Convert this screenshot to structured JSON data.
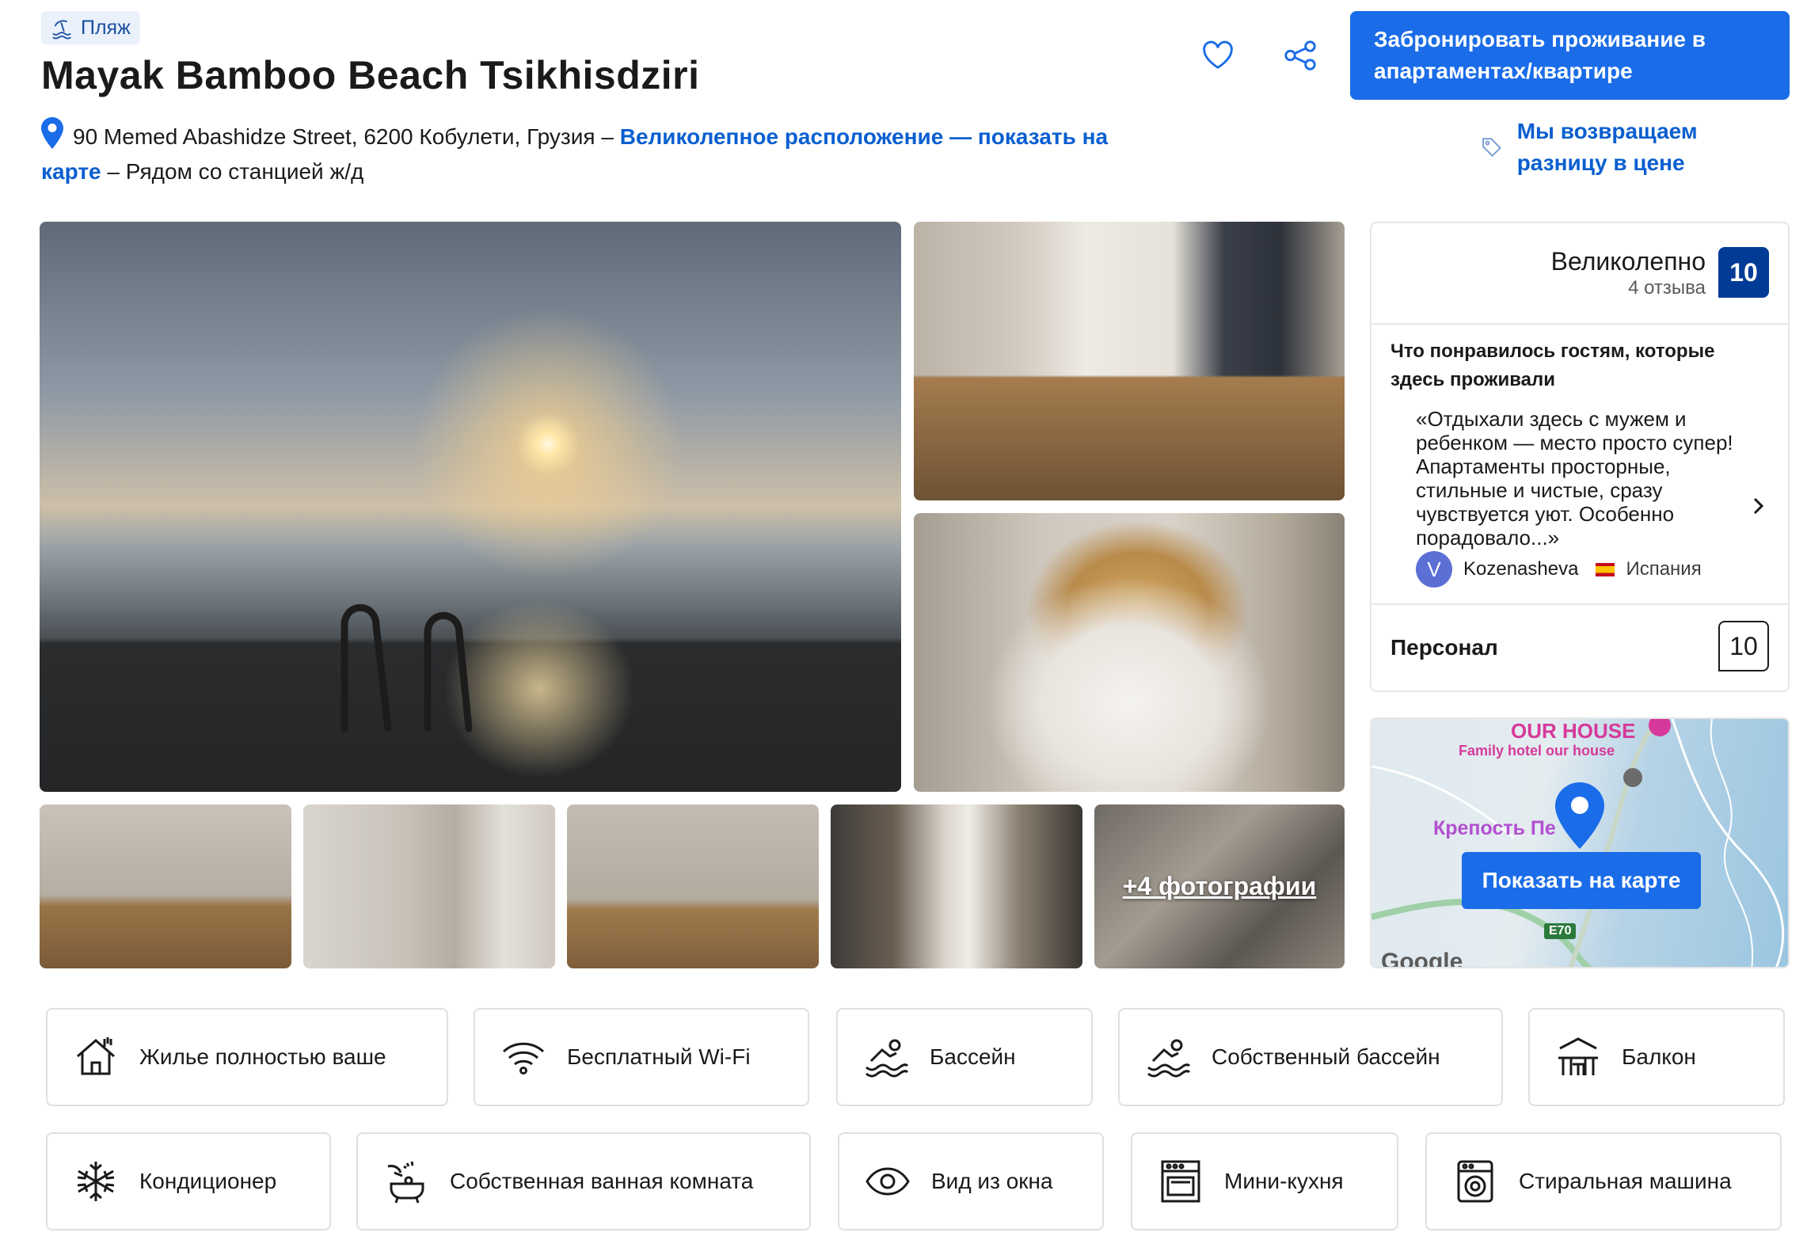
{
  "header": {
    "badge": "Пляж",
    "title": "Mayak Bamboo Beach Tsikhisdziri",
    "address": "90 Memed Abashidze Street, 6200 Кобулети, Грузия",
    "separator": " – ",
    "map_link": "Великолепное расположение — показать на карте",
    "nearby": "Рядом со станцией ж/д",
    "book_button": "Забронировать проживание в апартаментах/квартире",
    "price_promise": "Мы возвращаем разницу в цене"
  },
  "gallery": {
    "more_photos": "+4 фотографии"
  },
  "review": {
    "rating_word": "Великолепно",
    "review_count": "4 отзыва",
    "score": "10",
    "liked_heading": "Что понравилось гостям, которые здесь проживали",
    "quote": "«Отдыхали здесь с мужем и ребенком — место просто супер! Апартаменты просторные, стильные и чистые, сразу чувствуется уют. Особенно порадовало...»",
    "author_initial": "V",
    "author_name": "Kozenasheva",
    "author_country": "Испания",
    "staff_label": "Персонал",
    "staff_score": "10"
  },
  "map": {
    "label_ourhouse": "OUR HOUSE",
    "label_family": "Family hotel our house",
    "label_fortress": "Крепость Пе",
    "road": "E70",
    "google": "Google",
    "button": "Показать на карте"
  },
  "facilities": [
    {
      "label": "Жилье полностью ваше",
      "icon": "house-icon"
    },
    {
      "label": "Бесплатный Wi-Fi",
      "icon": "wifi-icon"
    },
    {
      "label": "Бассейн",
      "icon": "pool-icon"
    },
    {
      "label": "Собственный бассейн",
      "icon": "pool-icon"
    },
    {
      "label": "Балкон",
      "icon": "balcony-icon"
    },
    {
      "label": "Кондиционер",
      "icon": "snowflake-icon"
    },
    {
      "label": "Собственная ванная комната",
      "icon": "bath-icon"
    },
    {
      "label": "Вид из окна",
      "icon": "eye-icon"
    },
    {
      "label": "Мини-кухня",
      "icon": "oven-icon"
    },
    {
      "label": "Стиральная машина",
      "icon": "washing-machine-icon"
    }
  ],
  "colors": {
    "primary": "#1a6ce8",
    "link": "#0a5fd0",
    "score_bg": "#003b95"
  }
}
